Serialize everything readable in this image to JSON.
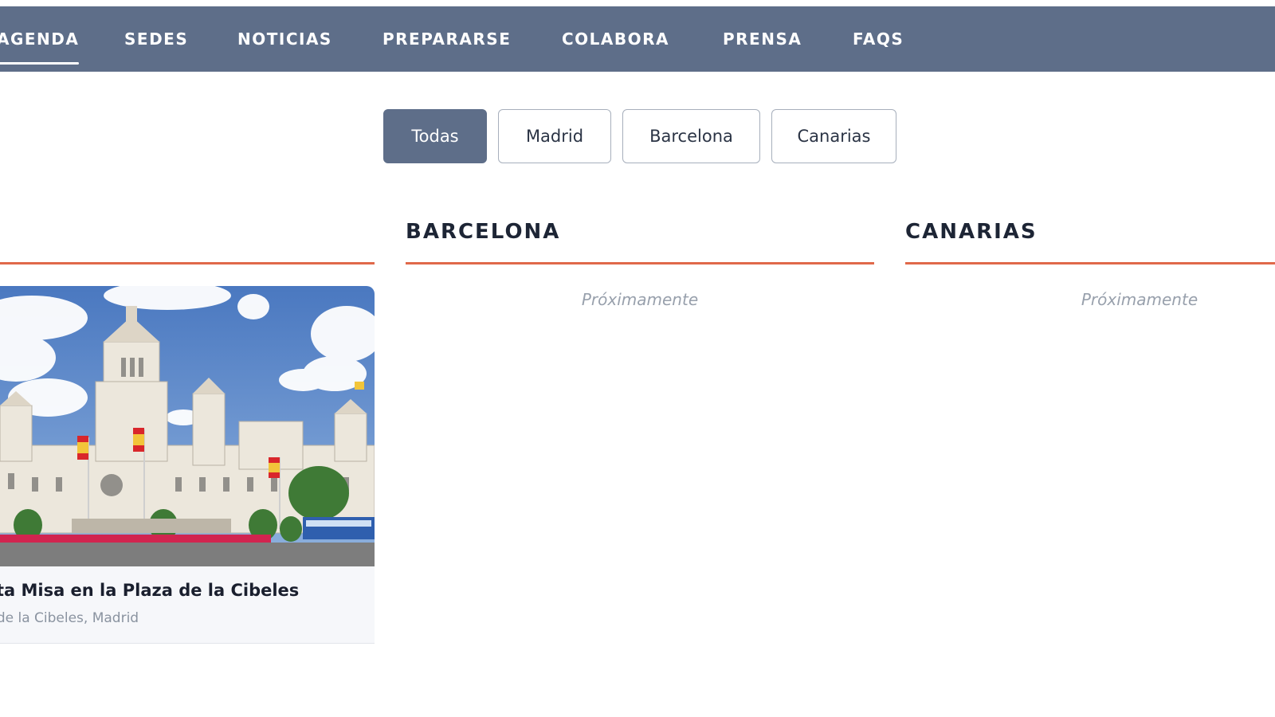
{
  "nav": {
    "items": [
      {
        "label": "AGENDA",
        "active": true
      },
      {
        "label": "SEDES"
      },
      {
        "label": "NOTICIAS"
      },
      {
        "label": "PREPARARSE"
      },
      {
        "label": "COLABORA"
      },
      {
        "label": "PRENSA"
      },
      {
        "label": "FAQS"
      }
    ]
  },
  "filters": {
    "items": [
      "Todas",
      "Madrid",
      "Barcelona",
      "Canarias"
    ],
    "selected": "Todas"
  },
  "columns": [
    {
      "title": ""
    },
    {
      "title": "BARCELONA",
      "empty_text": "Próximamente"
    },
    {
      "title": "CANARIAS",
      "empty_text": "Próximamente"
    }
  ],
  "event_card": {
    "title": "Santa Misa en la Plaza de la Cibeles",
    "visible_title": "nta Misa en la Plaza de la Cibeles",
    "location": "Plaza de la Cibeles, Madrid",
    "visible_location": "a de la Cibeles, Madrid",
    "image_description": "palacio-de-cibeles-photo"
  },
  "colors": {
    "nav_bg": "#5e6e89",
    "accent": "#e0694a",
    "heading": "#1d2535",
    "muted": "#98a0ac"
  }
}
